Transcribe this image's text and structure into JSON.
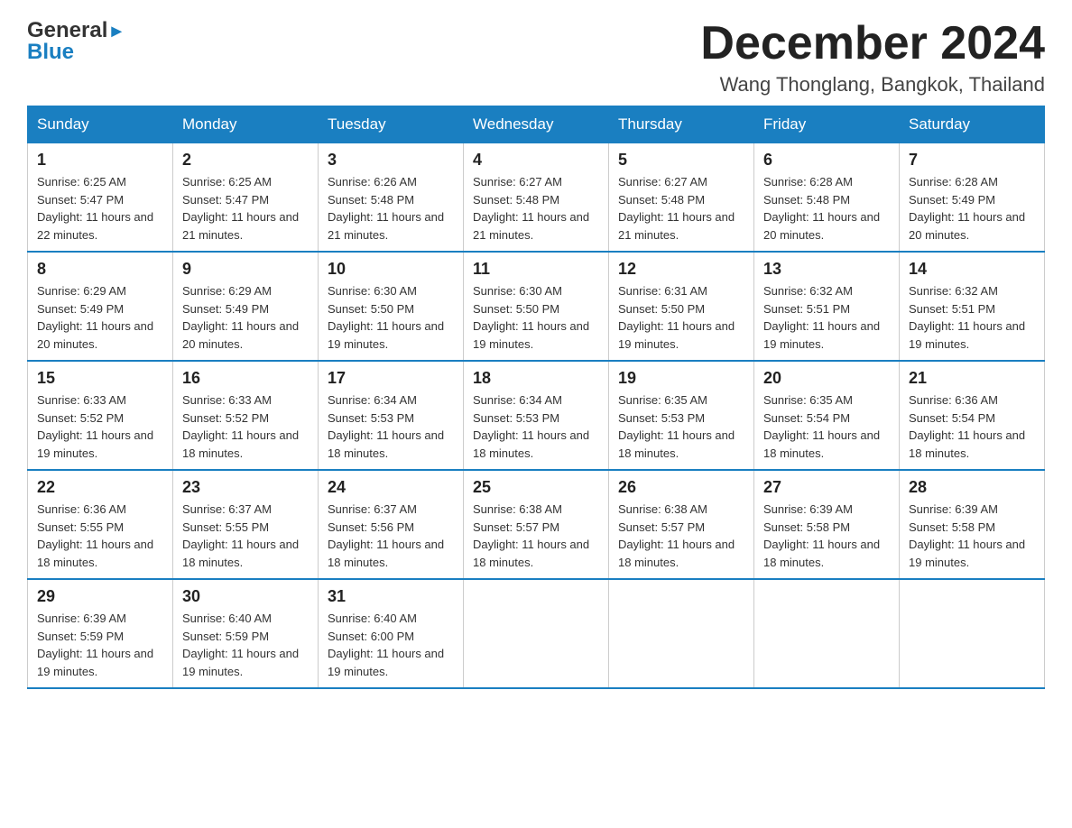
{
  "header": {
    "logo_line1": "General",
    "logo_line2": "Blue",
    "title": "December 2024",
    "subtitle": "Wang Thonglang, Bangkok, Thailand"
  },
  "days_of_week": [
    "Sunday",
    "Monday",
    "Tuesday",
    "Wednesday",
    "Thursday",
    "Friday",
    "Saturday"
  ],
  "weeks": [
    [
      {
        "date": "1",
        "sunrise": "6:25 AM",
        "sunset": "5:47 PM",
        "daylight": "11 hours and 22 minutes."
      },
      {
        "date": "2",
        "sunrise": "6:25 AM",
        "sunset": "5:47 PM",
        "daylight": "11 hours and 21 minutes."
      },
      {
        "date": "3",
        "sunrise": "6:26 AM",
        "sunset": "5:48 PM",
        "daylight": "11 hours and 21 minutes."
      },
      {
        "date": "4",
        "sunrise": "6:27 AM",
        "sunset": "5:48 PM",
        "daylight": "11 hours and 21 minutes."
      },
      {
        "date": "5",
        "sunrise": "6:27 AM",
        "sunset": "5:48 PM",
        "daylight": "11 hours and 21 minutes."
      },
      {
        "date": "6",
        "sunrise": "6:28 AM",
        "sunset": "5:48 PM",
        "daylight": "11 hours and 20 minutes."
      },
      {
        "date": "7",
        "sunrise": "6:28 AM",
        "sunset": "5:49 PM",
        "daylight": "11 hours and 20 minutes."
      }
    ],
    [
      {
        "date": "8",
        "sunrise": "6:29 AM",
        "sunset": "5:49 PM",
        "daylight": "11 hours and 20 minutes."
      },
      {
        "date": "9",
        "sunrise": "6:29 AM",
        "sunset": "5:49 PM",
        "daylight": "11 hours and 20 minutes."
      },
      {
        "date": "10",
        "sunrise": "6:30 AM",
        "sunset": "5:50 PM",
        "daylight": "11 hours and 19 minutes."
      },
      {
        "date": "11",
        "sunrise": "6:30 AM",
        "sunset": "5:50 PM",
        "daylight": "11 hours and 19 minutes."
      },
      {
        "date": "12",
        "sunrise": "6:31 AM",
        "sunset": "5:50 PM",
        "daylight": "11 hours and 19 minutes."
      },
      {
        "date": "13",
        "sunrise": "6:32 AM",
        "sunset": "5:51 PM",
        "daylight": "11 hours and 19 minutes."
      },
      {
        "date": "14",
        "sunrise": "6:32 AM",
        "sunset": "5:51 PM",
        "daylight": "11 hours and 19 minutes."
      }
    ],
    [
      {
        "date": "15",
        "sunrise": "6:33 AM",
        "sunset": "5:52 PM",
        "daylight": "11 hours and 19 minutes."
      },
      {
        "date": "16",
        "sunrise": "6:33 AM",
        "sunset": "5:52 PM",
        "daylight": "11 hours and 18 minutes."
      },
      {
        "date": "17",
        "sunrise": "6:34 AM",
        "sunset": "5:53 PM",
        "daylight": "11 hours and 18 minutes."
      },
      {
        "date": "18",
        "sunrise": "6:34 AM",
        "sunset": "5:53 PM",
        "daylight": "11 hours and 18 minutes."
      },
      {
        "date": "19",
        "sunrise": "6:35 AM",
        "sunset": "5:53 PM",
        "daylight": "11 hours and 18 minutes."
      },
      {
        "date": "20",
        "sunrise": "6:35 AM",
        "sunset": "5:54 PM",
        "daylight": "11 hours and 18 minutes."
      },
      {
        "date": "21",
        "sunrise": "6:36 AM",
        "sunset": "5:54 PM",
        "daylight": "11 hours and 18 minutes."
      }
    ],
    [
      {
        "date": "22",
        "sunrise": "6:36 AM",
        "sunset": "5:55 PM",
        "daylight": "11 hours and 18 minutes."
      },
      {
        "date": "23",
        "sunrise": "6:37 AM",
        "sunset": "5:55 PM",
        "daylight": "11 hours and 18 minutes."
      },
      {
        "date": "24",
        "sunrise": "6:37 AM",
        "sunset": "5:56 PM",
        "daylight": "11 hours and 18 minutes."
      },
      {
        "date": "25",
        "sunrise": "6:38 AM",
        "sunset": "5:57 PM",
        "daylight": "11 hours and 18 minutes."
      },
      {
        "date": "26",
        "sunrise": "6:38 AM",
        "sunset": "5:57 PM",
        "daylight": "11 hours and 18 minutes."
      },
      {
        "date": "27",
        "sunrise": "6:39 AM",
        "sunset": "5:58 PM",
        "daylight": "11 hours and 18 minutes."
      },
      {
        "date": "28",
        "sunrise": "6:39 AM",
        "sunset": "5:58 PM",
        "daylight": "11 hours and 19 minutes."
      }
    ],
    [
      {
        "date": "29",
        "sunrise": "6:39 AM",
        "sunset": "5:59 PM",
        "daylight": "11 hours and 19 minutes."
      },
      {
        "date": "30",
        "sunrise": "6:40 AM",
        "sunset": "5:59 PM",
        "daylight": "11 hours and 19 minutes."
      },
      {
        "date": "31",
        "sunrise": "6:40 AM",
        "sunset": "6:00 PM",
        "daylight": "11 hours and 19 minutes."
      },
      null,
      null,
      null,
      null
    ]
  ]
}
